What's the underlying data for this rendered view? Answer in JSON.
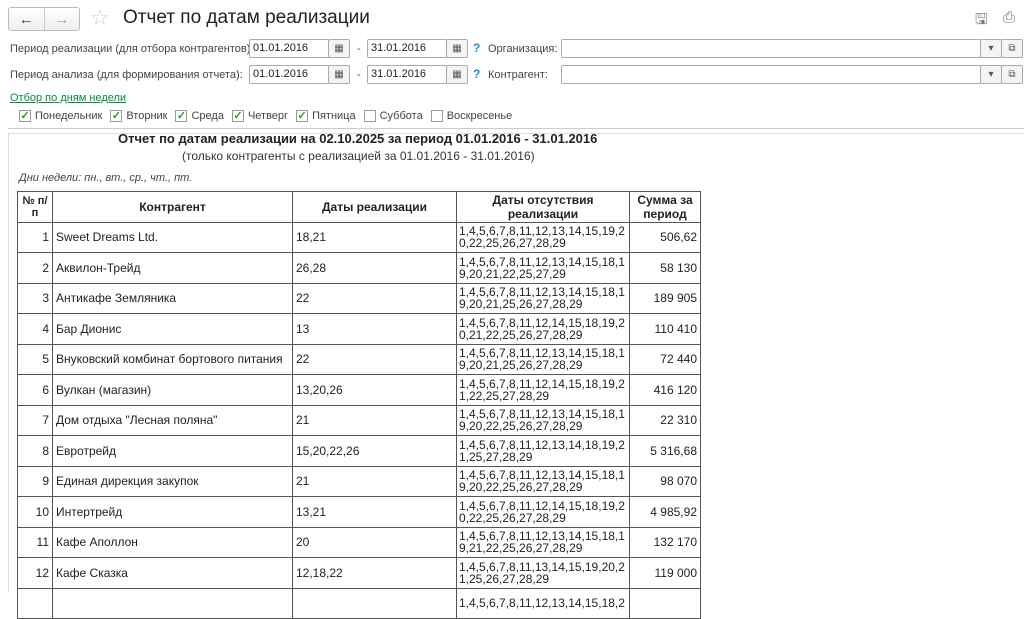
{
  "header": {
    "title": "Отчет по датам реализации",
    "back": "←",
    "forward": "→"
  },
  "filters": {
    "period_sale_label": "Период реализации (для отбора контрагентов):",
    "period_sale_from": "01.01.2016",
    "period_sale_to": "31.01.2016",
    "period_analysis_label": "Период анализа (для формирования отчета):",
    "period_analysis_from": "01.01.2016",
    "period_analysis_to": "31.01.2016",
    "dash": "-",
    "help": "?",
    "org_label": "Организация:",
    "org_value": "",
    "contractor_label": "Контрагент:",
    "contractor_value": ""
  },
  "weekdays": {
    "link": "Отбор по дням недели",
    "days": [
      {
        "label": "Понедельник",
        "checked": true
      },
      {
        "label": "Вторник",
        "checked": true
      },
      {
        "label": "Среда",
        "checked": true
      },
      {
        "label": "Четверг",
        "checked": true
      },
      {
        "label": "Пятница",
        "checked": true
      },
      {
        "label": "Суббота",
        "checked": false
      },
      {
        "label": "Воскресенье",
        "checked": false
      }
    ]
  },
  "report": {
    "title": "Отчет по датам реализации на 02.10.2025 за период 01.01.2016 - 31.01.2016",
    "subtitle": "(только контрагенты с реализацией за 01.01.2016 - 31.01.2016)",
    "days_note": "Дни недели: пн., вт., ср., чт., пт.",
    "columns": [
      "№ п/п",
      "Контрагент",
      "Даты реализации",
      "Даты отсутствия реализации",
      "Сумма за период"
    ],
    "rows": [
      [
        "1",
        "Sweet Dreams Ltd.",
        "18,21",
        "1,4,5,6,7,8,11,12,13,14,15,19,20,22,25,26,27,28,29",
        "506,62"
      ],
      [
        "2",
        "Аквилон-Трейд",
        "26,28",
        "1,4,5,6,7,8,11,12,13,14,15,18,19,20,21,22,25,27,29",
        "58 130"
      ],
      [
        "3",
        "Антикафе Земляника",
        "22",
        "1,4,5,6,7,8,11,12,13,14,15,18,19,20,21,25,26,27,28,29",
        "189 905"
      ],
      [
        "4",
        "Бар Дионис",
        "13",
        "1,4,5,6,7,8,11,12,14,15,18,19,20,21,22,25,26,27,28,29",
        "110 410"
      ],
      [
        "5",
        "Внуковский комбинат бортового питания",
        "22",
        "1,4,5,6,7,8,11,12,13,14,15,18,19,20,21,25,26,27,28,29",
        "72 440"
      ],
      [
        "6",
        "Вулкан (магазин)",
        "13,20,26",
        "1,4,5,6,7,8,11,12,14,15,18,19,21,22,25,27,28,29",
        "416 120"
      ],
      [
        "7",
        "Дом отдыха \"Лесная поляна\"",
        "21",
        "1,4,5,6,7,8,11,12,13,14,15,18,19,20,22,25,26,27,28,29",
        "22 310"
      ],
      [
        "8",
        "Евротрейд",
        "15,20,22,26",
        "1,4,5,6,7,8,11,12,13,14,18,19,21,25,27,28,29",
        "5 316,68"
      ],
      [
        "9",
        "Единая дирекция закупок",
        "21",
        "1,4,5,6,7,8,11,12,13,14,15,18,19,20,22,25,26,27,28,29",
        "98 070"
      ],
      [
        "10",
        "Интертрейд",
        "13,21",
        "1,4,5,6,7,8,11,12,14,15,18,19,20,22,25,26,27,28,29",
        "4 985,92"
      ],
      [
        "11",
        "Кафе Аполлон",
        "20",
        "1,4,5,6,7,8,11,12,13,14,15,18,19,21,22,25,26,27,28,29",
        "132 170"
      ],
      [
        "12",
        "Кафе Сказка",
        "12,18,22",
        "1,4,5,6,7,8,11,13,14,15,19,20,21,25,26,27,28,29",
        "119 000"
      ],
      [
        "",
        "",
        "",
        "1,4,5,6,7,8,11,12,13,14,15,18,2",
        ""
      ]
    ]
  }
}
